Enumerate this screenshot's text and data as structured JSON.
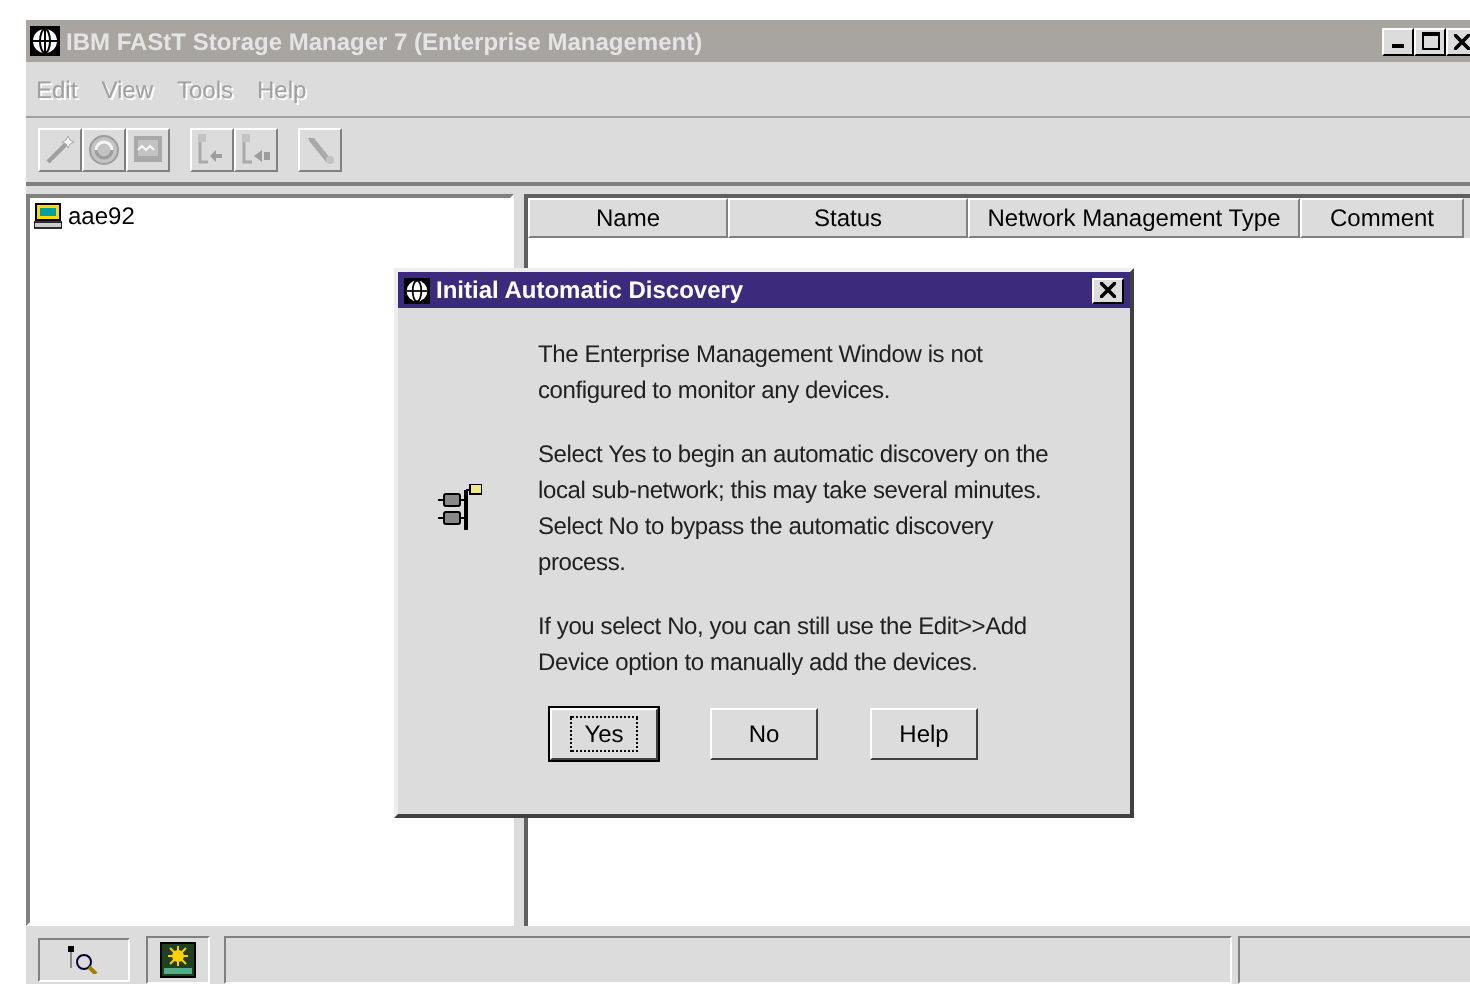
{
  "window": {
    "title": "IBM FAStT Storage Manager 7 (Enterprise Management)",
    "active": false
  },
  "menu": [
    {
      "label": "Edit",
      "disabled": true
    },
    {
      "label": "View",
      "disabled": true
    },
    {
      "label": "Tools",
      "disabled": true
    },
    {
      "label": "Help",
      "disabled": true
    }
  ],
  "toolbar": [
    {
      "kind": "wand",
      "disabled": true
    },
    {
      "kind": "scan",
      "disabled": true
    },
    {
      "kind": "monitor",
      "disabled": true
    },
    {
      "kind": "sep"
    },
    {
      "kind": "collapse",
      "disabled": true
    },
    {
      "kind": "expand",
      "disabled": true
    },
    {
      "kind": "sep"
    },
    {
      "kind": "wrench",
      "disabled": true
    }
  ],
  "tree": {
    "items": [
      {
        "label": "aae92",
        "selected": false
      }
    ]
  },
  "table": {
    "columns": [
      "Name",
      "Status",
      "Network Management Type",
      "Comment"
    ]
  },
  "dialog": {
    "title": "Initial Automatic Discovery",
    "paragraphs": [
      "The Enterprise Management Window is not configured to monitor any devices.",
      "Select Yes to begin an automatic discovery on the local sub-network; this may take several minutes. Select No to bypass the automatic discovery process.",
      "If you select No, you can still use the Edit>>Add Device option to manually add the devices."
    ],
    "buttons": [
      {
        "label": "Yes",
        "focused": true
      },
      {
        "label": "No",
        "focused": false
      },
      {
        "label": "Help",
        "focused": false
      }
    ]
  },
  "status_bar": {
    "icons": [
      {
        "kind": "find"
      },
      {
        "kind": "monitor"
      }
    ]
  }
}
